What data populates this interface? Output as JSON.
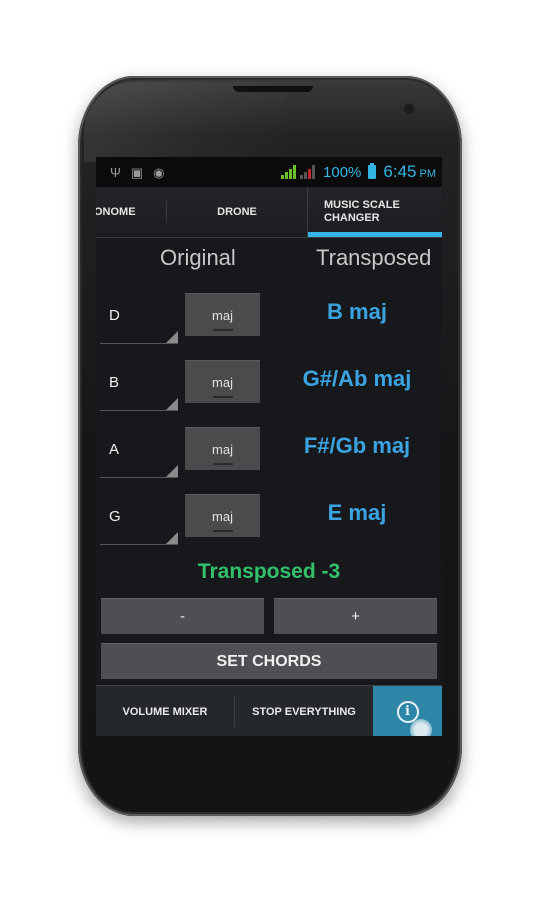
{
  "status_bar": {
    "left_icons": [
      "usb-icon",
      "image-icon",
      "android-icon"
    ],
    "battery_percent": "100%",
    "time": "6:45",
    "ampm": "PM",
    "accent_color": "#33b5e5"
  },
  "tabs": [
    {
      "label": "ONOME",
      "selected": false
    },
    {
      "label": "DRONE",
      "selected": false
    },
    {
      "label_line1": "MUSIC SCALE",
      "label_line2": "CHANGER",
      "selected": true
    }
  ],
  "columns": {
    "original": "Original",
    "transposed": "Transposed"
  },
  "rows": [
    {
      "root": "D",
      "quality": "maj",
      "transposed": "B maj"
    },
    {
      "root": "B",
      "quality": "maj",
      "transposed": "G#/Ab maj"
    },
    {
      "root": "A",
      "quality": "maj",
      "transposed": "F#/Gb maj"
    },
    {
      "root": "G",
      "quality": "maj",
      "transposed": "E maj"
    }
  ],
  "transposition": {
    "label": "Transposed -3",
    "color": "#32c16a"
  },
  "buttons": {
    "minus": "-",
    "plus": "+",
    "set_chords": "SET CHORDS"
  },
  "bottom_bar": {
    "volume_mixer": "VOLUME MIXER",
    "stop_everything": "STOP EVERYTHING",
    "info_glyph": "i"
  }
}
